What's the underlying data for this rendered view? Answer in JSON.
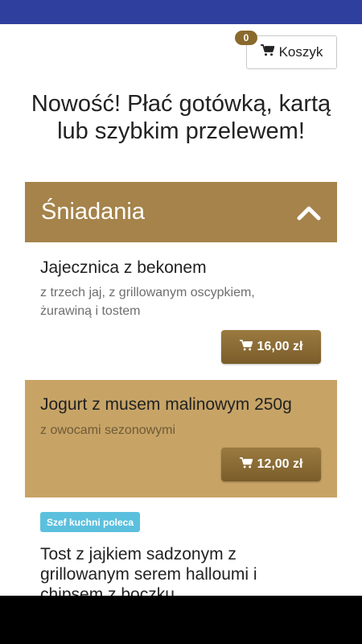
{
  "cart": {
    "count": "0",
    "label": "Koszyk",
    "icon": "cart-icon"
  },
  "headline": "Nowość! Płać gotówką, kartą lub szybkim przelewem!",
  "category": {
    "title": "Śniadania",
    "icon": "chevron-up-icon",
    "color": "#a5834a"
  },
  "products": [
    {
      "name": "Jajecznica z bekonem",
      "description": "z trzech jaj, z grillowanym oscypkiem, żurawiną i tostem",
      "price": "16,00 zł"
    },
    {
      "name": "Jogurt z musem malinowym 250g",
      "description": "z owocami sezonowymi",
      "price": "12,00 zł",
      "highlight_color": "#c7a466"
    },
    {
      "badge": "Szef kuchni poleca",
      "name": "Tost z jajkiem sadzonym z grillowanym serem halloumi i chipsem z boczku"
    }
  ],
  "colors": {
    "status_bar": "#2f3f9e",
    "price_button": "#8a6a2c",
    "badge": "#5bc0de"
  }
}
